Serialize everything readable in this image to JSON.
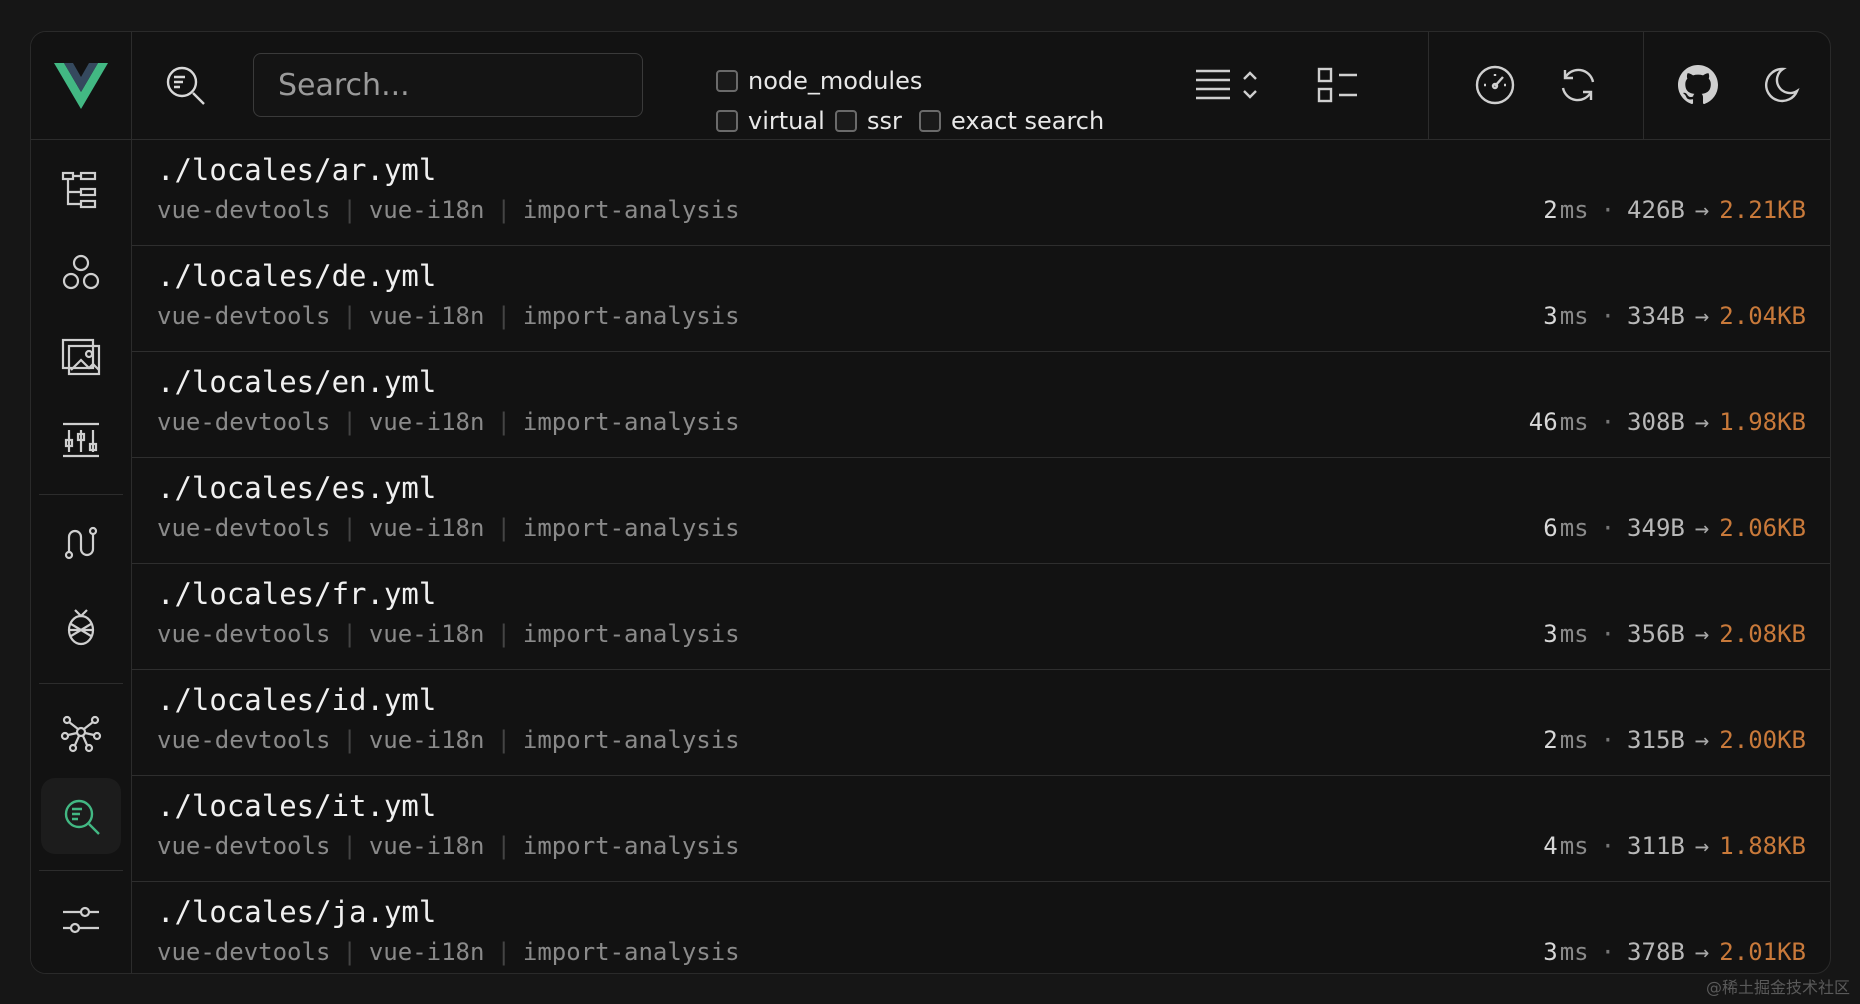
{
  "colors": {
    "accent": "#42b883",
    "size_output": "#c8793a",
    "text_primary": "#f0f0f0",
    "text_muted": "#8a8a8a"
  },
  "toolbar": {
    "search_placeholder": "Search...",
    "filters": [
      {
        "label": "node_modules",
        "checked": false
      },
      {
        "label": "virtual",
        "checked": false
      },
      {
        "label": "ssr",
        "checked": false
      },
      {
        "label": "exact search",
        "checked": false
      }
    ]
  },
  "sidebar": {
    "items": [
      {
        "icon": "file-tree-icon"
      },
      {
        "icon": "components-icon"
      },
      {
        "icon": "assets-image-icon"
      },
      {
        "icon": "timeline-icon"
      },
      {
        "icon": "routes-icon"
      },
      {
        "icon": "pinia-icon"
      },
      {
        "icon": "graph-icon"
      },
      {
        "icon": "inspect-icon",
        "active": true
      },
      {
        "icon": "settings-sliders-icon"
      }
    ]
  },
  "modules": [
    {
      "path": "./locales/ar.yml",
      "plugins": [
        "vue-devtools",
        "vue-i18n",
        "import-analysis"
      ],
      "ms": "2",
      "ms_unit": "ms",
      "size_in": "426B",
      "size_out": "2.21KB"
    },
    {
      "path": "./locales/de.yml",
      "plugins": [
        "vue-devtools",
        "vue-i18n",
        "import-analysis"
      ],
      "ms": "3",
      "ms_unit": "ms",
      "size_in": "334B",
      "size_out": "2.04KB"
    },
    {
      "path": "./locales/en.yml",
      "plugins": [
        "vue-devtools",
        "vue-i18n",
        "import-analysis"
      ],
      "ms": "46",
      "ms_unit": "ms",
      "size_in": "308B",
      "size_out": "1.98KB"
    },
    {
      "path": "./locales/es.yml",
      "plugins": [
        "vue-devtools",
        "vue-i18n",
        "import-analysis"
      ],
      "ms": "6",
      "ms_unit": "ms",
      "size_in": "349B",
      "size_out": "2.06KB"
    },
    {
      "path": "./locales/fr.yml",
      "plugins": [
        "vue-devtools",
        "vue-i18n",
        "import-analysis"
      ],
      "ms": "3",
      "ms_unit": "ms",
      "size_in": "356B",
      "size_out": "2.08KB"
    },
    {
      "path": "./locales/id.yml",
      "plugins": [
        "vue-devtools",
        "vue-i18n",
        "import-analysis"
      ],
      "ms": "2",
      "ms_unit": "ms",
      "size_in": "315B",
      "size_out": "2.00KB"
    },
    {
      "path": "./locales/it.yml",
      "plugins": [
        "vue-devtools",
        "vue-i18n",
        "import-analysis"
      ],
      "ms": "4",
      "ms_unit": "ms",
      "size_in": "311B",
      "size_out": "1.88KB"
    },
    {
      "path": "./locales/ja.yml",
      "plugins": [
        "vue-devtools",
        "vue-i18n",
        "import-analysis"
      ],
      "ms": "3",
      "ms_unit": "ms",
      "size_in": "378B",
      "size_out": "2.01KB"
    }
  ],
  "watermark": "@稀土掘金技术社区"
}
